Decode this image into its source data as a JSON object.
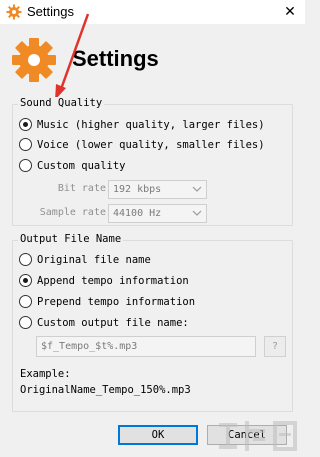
{
  "window": {
    "title": "Settings",
    "close_glyph": "✕"
  },
  "header": {
    "heading": "Settings"
  },
  "sound_quality": {
    "legend": "Sound Quality",
    "options": [
      {
        "label": "Music (higher quality, larger files)",
        "checked": true
      },
      {
        "label": "Voice (lower quality, smaller files)",
        "checked": false
      },
      {
        "label": "Custom quality",
        "checked": false
      }
    ],
    "bit_rate": {
      "label": "Bit rate",
      "value": "192 kbps"
    },
    "sample_rate": {
      "label": "Sample rate",
      "value": "44100 Hz"
    }
  },
  "output_file_name": {
    "legend": "Output File Name",
    "options": [
      {
        "label": "Original file name",
        "checked": false
      },
      {
        "label": "Append tempo information",
        "checked": true
      },
      {
        "label": "Prepend tempo information",
        "checked": false
      },
      {
        "label": "Custom output file name:",
        "checked": false
      }
    ],
    "custom_pattern": "$f_Tempo_$t%.mp3",
    "help_label": "?",
    "example_label": "Example:",
    "example_value": "OriginalName_Tempo_150%.mp3"
  },
  "buttons": {
    "ok": "OK",
    "cancel": "Cancel"
  },
  "colors": {
    "accent": "#0078d7",
    "gear": "#f08a24",
    "arrow": "#e0332b"
  },
  "icons": {
    "app": "gear-icon",
    "header": "gear-icon",
    "combo": "chevron-down-icon",
    "close": "close-icon"
  }
}
